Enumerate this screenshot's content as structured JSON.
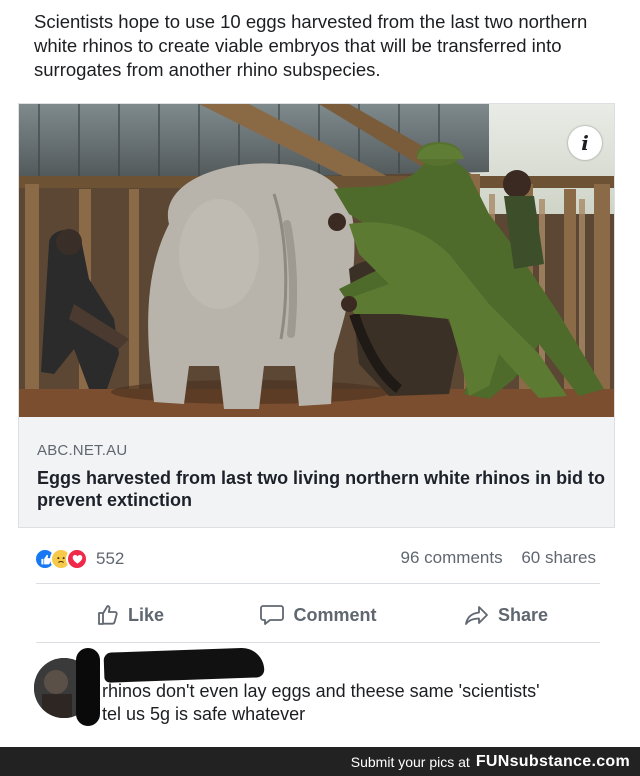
{
  "post": {
    "text": "Scientists hope to use 10 eggs harvested from the last two northern white rhinos to create viable embryos that will be transferred into surrogates from another rhino subspecies."
  },
  "link": {
    "source": "ABC.NET.AU",
    "headline": "Eggs harvested from last two living northern white rhinos in bid to prevent extinction",
    "info_icon": "i"
  },
  "reactions": {
    "icons": [
      "like-icon",
      "sad-icon",
      "love-icon"
    ],
    "count": "552",
    "comments": "96 comments",
    "shares": "60 shares"
  },
  "actions": {
    "like": "Like",
    "comment": "Comment",
    "share": "Share"
  },
  "comment": {
    "text": "rhinos don't even lay eggs and theese same 'scientists' tel us 5g is safe whatever"
  },
  "footer": {
    "prompt": "Submit your pics at",
    "brand": "FUNsubstance.com"
  },
  "colors": {
    "like_blue": "#1877f2",
    "love_red": "#f0284a",
    "sad_yellow": "#f7c94b",
    "footer_bg": "#222222"
  }
}
